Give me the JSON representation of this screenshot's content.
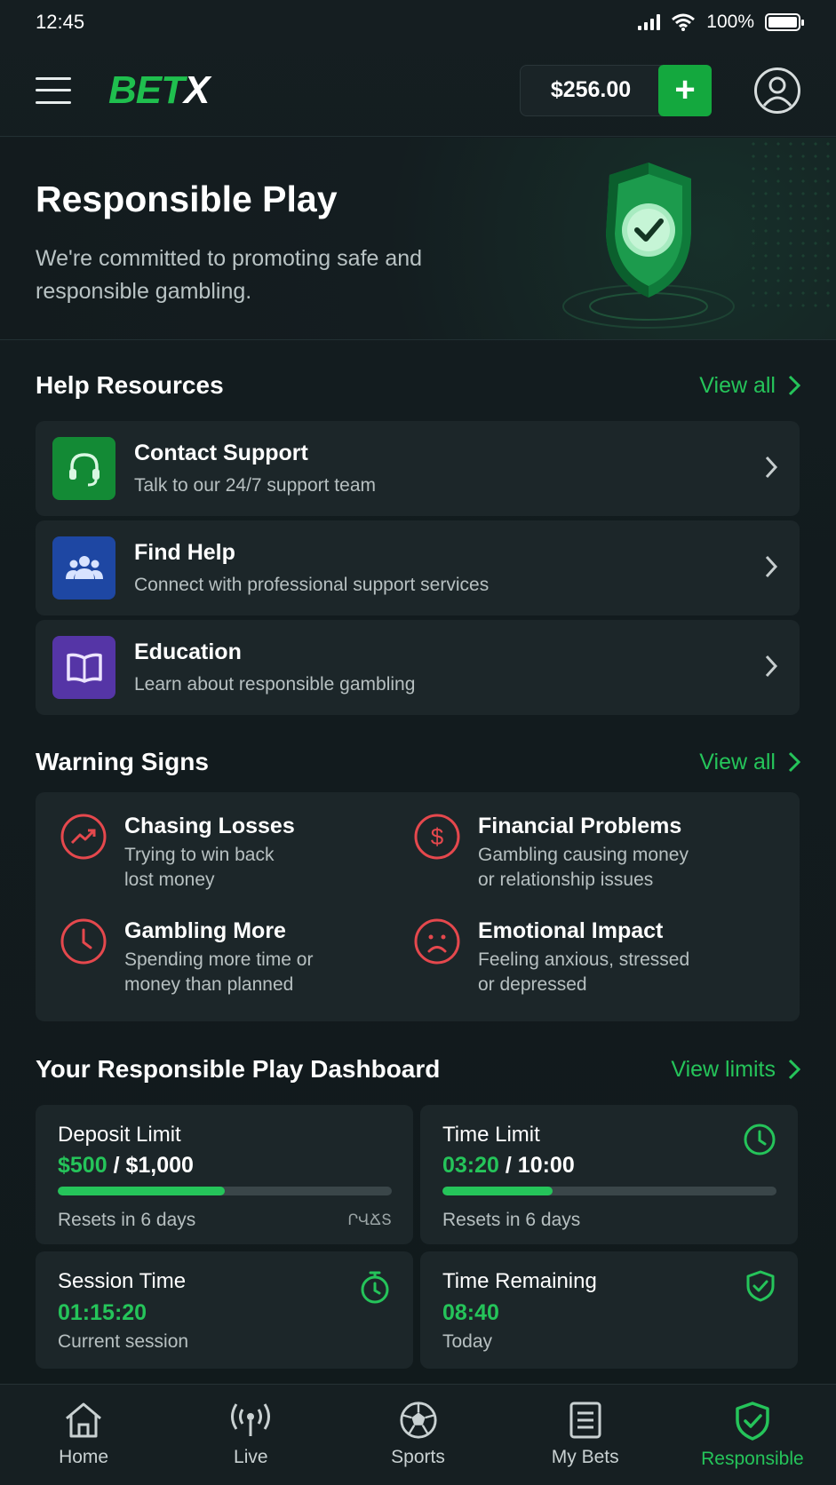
{
  "status_bar": {
    "time": "12:45",
    "battery": "100%"
  },
  "header": {
    "logo_bet": "BET",
    "logo_x": "X",
    "balance": "$256.00",
    "deposit_label": "+"
  },
  "hero": {
    "title": "Responsible Play",
    "subtitle": "We're committed to promoting safe and responsible gambling.",
    "icon": "shield-check-icon"
  },
  "help_resources": {
    "title": "Help Resources",
    "view_all": "View all",
    "items": [
      {
        "title": "Contact Support",
        "subtitle": "Talk to our 24/7 support team",
        "icon": "headset-icon",
        "color": "#138a35"
      },
      {
        "title": "Find Help",
        "subtitle": "Connect with professional support services",
        "icon": "people-icon",
        "color": "#1e47a3"
      },
      {
        "title": "Education",
        "subtitle": "Learn about responsible gambling",
        "icon": "book-icon",
        "color": "#5535a6"
      }
    ]
  },
  "warning_signs": {
    "title": "Warning Signs",
    "view_all": "View all",
    "items": [
      {
        "title": "Chasing Losses",
        "line1": "Trying to win back",
        "line2": "lost money",
        "icon": "trending-up-icon"
      },
      {
        "title": "Financial Problems",
        "line1": "Gambling causing money",
        "line2": "or relationship issues",
        "icon": "dollar-icon"
      },
      {
        "title": "Gambling More",
        "line1": "Spending more time or",
        "line2": "money than planned",
        "icon": "clock-icon"
      },
      {
        "title": "Emotional Impact",
        "line1": "Feeling anxious, stressed",
        "line2": "or depressed",
        "icon": "sad-face-icon"
      }
    ]
  },
  "dashboard": {
    "title": "Your Responsible Play Dashboard",
    "view_limits": "View limits",
    "deposit_limit": {
      "label": "Deposit Limit",
      "used": "$500",
      "separator": " / ",
      "total": "$1,000",
      "progress": 0.5,
      "resets": "Resets in 6 days",
      "badge": "ՐՎՃՏ"
    },
    "time_limit": {
      "label": "Time Limit",
      "used": "03:20",
      "separator": " / ",
      "total": "10:00",
      "progress": 0.33,
      "resets": "Resets in 6 days",
      "icon": "clock-icon"
    },
    "session_time": {
      "label": "Session Time",
      "value": "01:15:20",
      "sub": "Current session",
      "icon": "stopwatch-icon"
    },
    "time_remaining": {
      "label": "Time Remaining",
      "value": "08:40",
      "sub": "Today",
      "icon": "shield-check-icon"
    }
  },
  "bottom_nav": {
    "items": [
      {
        "label": "Home",
        "icon": "home-icon"
      },
      {
        "label": "Live",
        "icon": "broadcast-icon"
      },
      {
        "label": "Sports",
        "icon": "soccer-ball-icon"
      },
      {
        "label": "My Bets",
        "icon": "document-icon"
      },
      {
        "label": "Responsible",
        "icon": "shield-check-icon",
        "active": true
      }
    ]
  },
  "colors": {
    "accent": "#25c45a",
    "danger": "#e5484d",
    "background": "#121a1d",
    "card": "#1c2629"
  }
}
